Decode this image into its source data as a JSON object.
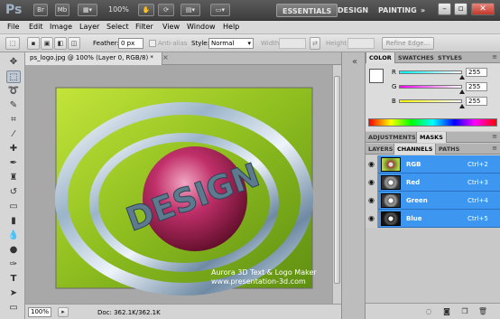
{
  "app": {
    "logo": "Ps",
    "zoom": "100%",
    "bar_icons": [
      "Br",
      "Mb"
    ]
  },
  "workspaces": [
    "ESSENTIALS",
    "DESIGN",
    "PAINTING",
    "»"
  ],
  "menu": [
    "File",
    "Edit",
    "Image",
    "Layer",
    "Select",
    "Filter",
    "View",
    "Window",
    "Help"
  ],
  "options": {
    "feather_label": "Feather:",
    "feather_value": "0 px",
    "antialias_label": "Anti-alias",
    "style_label": "Style:",
    "style_value": "Normal",
    "width_label": "Width:",
    "height_label": "Height:",
    "refine_label": "Refine Edge..."
  },
  "document": {
    "tab_title": "ps_logo.jpg @ 100% (Layer 0, RGB/8) *",
    "zoom": "100%",
    "doc_info": "Doc: 362.1K/362.1K",
    "canvas_text": {
      "logo_word": "DESIGN",
      "watermark_line1": "Aurora 3D Text & Logo Maker",
      "watermark_line2": "www.presentation-3d.com"
    }
  },
  "color_panel": {
    "tabs": [
      "COLOR",
      "SWATCHES",
      "STYLES"
    ],
    "sliders": [
      {
        "label": "R",
        "value": "255",
        "color_from": "#00ffff",
        "color_to": "#ffffff"
      },
      {
        "label": "G",
        "value": "255",
        "color_from": "#ff00ff",
        "color_to": "#ffffff"
      },
      {
        "label": "B",
        "value": "255",
        "color_from": "#ffff00",
        "color_to": "#ffffff"
      }
    ]
  },
  "adjust_panel": {
    "tabs": [
      "ADJUSTMENTS",
      "MASKS"
    ]
  },
  "channels_panel": {
    "tabs": [
      "LAYERS",
      "CHANNELS",
      "PATHS"
    ],
    "rows": [
      {
        "name": "RGB",
        "shortcut": "Ctrl+2"
      },
      {
        "name": "Red",
        "shortcut": "Ctrl+3"
      },
      {
        "name": "Green",
        "shortcut": "Ctrl+4"
      },
      {
        "name": "Blue",
        "shortcut": "Ctrl+5"
      }
    ]
  },
  "colors": {
    "selection_blue": "#3d96f0",
    "canvas_green": "#9ccc2a"
  }
}
